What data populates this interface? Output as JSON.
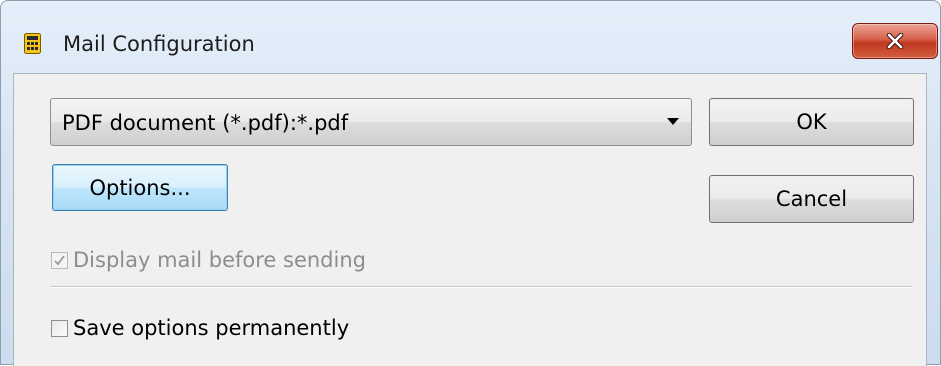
{
  "window": {
    "title": "Mail Configuration",
    "icon": "calculator-icon",
    "close_icon": "close-icon",
    "close_color": "#c9452a"
  },
  "form": {
    "format_select": {
      "value": "PDF document (*.pdf):*.pdf",
      "icon": "dropdown-arrow-icon"
    },
    "options_button": "Options...",
    "display_mail_checkbox": {
      "label": "Display mail before sending",
      "checked": true,
      "enabled": false
    },
    "save_options_checkbox": {
      "label": "Save options permanently",
      "checked": false,
      "enabled": true
    }
  },
  "buttons": {
    "ok": "OK",
    "cancel": "Cancel"
  }
}
